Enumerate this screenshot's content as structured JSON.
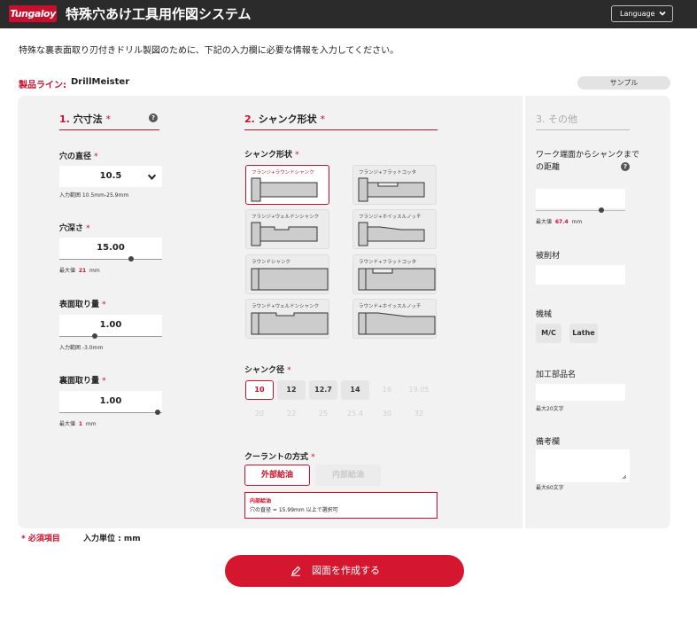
{
  "header": {
    "logo_text": "Tungaloy",
    "title": "特殊穴あけ工具用作図システム",
    "language_label": "Language"
  },
  "intro": "特殊な裏表面取り刃付きドリル製図のために、下記の入力欄に必要な情報を入力してください。",
  "product": {
    "label": "製品ライン:",
    "value": "DrillMeister",
    "sample_button": "サンプル"
  },
  "section1": {
    "num": "1.",
    "title": "穴寸法",
    "req": "*",
    "help": "?",
    "hole_diameter": {
      "label": "穴の直径",
      "value": "10.5",
      "hint": "入力範囲 10.5mm-25.9mm"
    },
    "hole_depth": {
      "label": "穴深さ",
      "value": "15.00",
      "hint_prefix": "最大値",
      "hint_value": "21",
      "hint_unit": "mm"
    },
    "front_chamfer": {
      "label": "表面取り量",
      "value": "1.00",
      "hint": "入力範囲 -3.0mm"
    },
    "back_chamfer": {
      "label": "裏面取り量",
      "value": "1.00",
      "hint_prefix": "最大値",
      "hint_value": "1",
      "hint_unit": "mm"
    }
  },
  "section2": {
    "num": "2.",
    "title": "シャンク形状",
    "req": "*",
    "shape_label": "シャンク形状",
    "shapes": [
      "フランジ+ラウンドシャンク",
      "フランジ+フラットコッタ",
      "フランジ+ウェルドンシャンク",
      "フランジ+ホイッスルノッチ",
      "ラウンドシャンク",
      "ラウンド+フラットコッタ",
      "ラウンド+ウェルドンシャンク",
      "ラウンド+ホイッスルノッチ"
    ],
    "diameter_label": "シャンク径",
    "diameters_row1": [
      "10",
      "12",
      "12.7",
      "14",
      "16",
      "19.05"
    ],
    "diameters_row2": [
      "20",
      "22",
      "25",
      "25.4",
      "30",
      "32"
    ],
    "coolant_label": "クーラントの方式",
    "coolant_external": "外部給油",
    "coolant_internal": "内部給油",
    "warning_title": "内部給油",
    "warning_body": "穴の直径 = 15.99mm 以上で選択可"
  },
  "section3": {
    "num": "3.",
    "title": "その他",
    "distance_label": "ワーク端面からシャンクまでの距離",
    "distance_help": "?",
    "distance_hint_prefix": "最大値",
    "distance_hint_value": "67.4",
    "distance_hint_unit": "mm",
    "material_label": "被削材",
    "machine_label": "機械",
    "machine_mc": "M/C",
    "machine_lathe": "Lathe",
    "part_name_label": "加工部品名",
    "part_name_hint": "最大20文字",
    "remarks_label": "備考欄",
    "remarks_hint": "最大60文字"
  },
  "legend": {
    "required": "* 必須項目",
    "unit": "入力単位 : mm"
  },
  "create_button": "図面を作成する",
  "colors": {
    "accent": "#c8102e",
    "header_bg": "#2b2b2b",
    "panel_bg": "#f2f2f2"
  }
}
